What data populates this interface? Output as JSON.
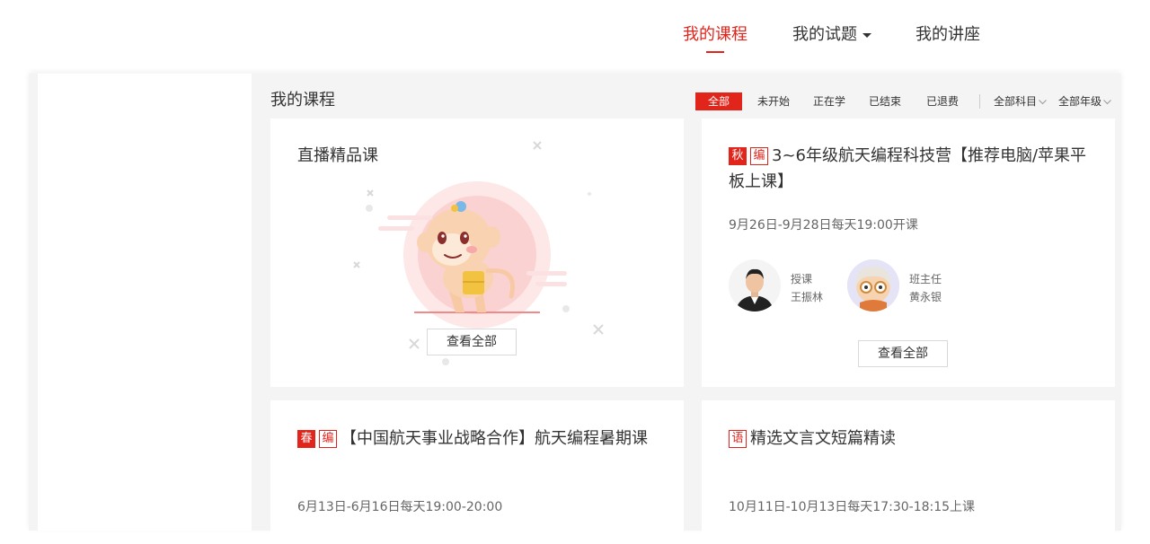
{
  "topnav": {
    "items": [
      {
        "label": "我的课程"
      },
      {
        "label": "我的试题"
      },
      {
        "label": "我的讲座"
      }
    ]
  },
  "main": {
    "title": "我的课程",
    "status_filters": [
      "全部",
      "未开始",
      "正在学",
      "已结束",
      "已退费"
    ],
    "subject_filter": "全部科目",
    "grade_filter": "全部年级",
    "live_card": {
      "title": "直播精品课",
      "button": "查看全部"
    },
    "courses": [
      {
        "tags": [
          {
            "text": "秋",
            "style": "solid"
          },
          {
            "text": "编",
            "style": "outline"
          }
        ],
        "title": "3~6年级航天编程科技营【推荐电脑/苹果平板上课】",
        "date": "9月26日-9月28日每天19:00开课",
        "teachers": [
          {
            "role": "授课",
            "name": "王振林",
            "avatar": "teacher-photo"
          },
          {
            "role": "班主任",
            "name": "黄永银",
            "avatar": "cartoon-avatar"
          }
        ],
        "button": "查看全部"
      },
      {
        "tags": [
          {
            "text": "春",
            "style": "solid"
          },
          {
            "text": "编",
            "style": "outline"
          }
        ],
        "title": "【中国航天事业战略合作】航天编程暑期课",
        "date": "6月13日-6月16日每天19:00-20:00"
      },
      {
        "tags": [
          {
            "text": "语",
            "style": "outline"
          }
        ],
        "title": "精选文言文短篇精读",
        "date": "10月11日-10月13日每天17:30-18:15上课"
      }
    ]
  },
  "colors": {
    "accent": "#e1251b",
    "background": "#f4f4f4"
  }
}
